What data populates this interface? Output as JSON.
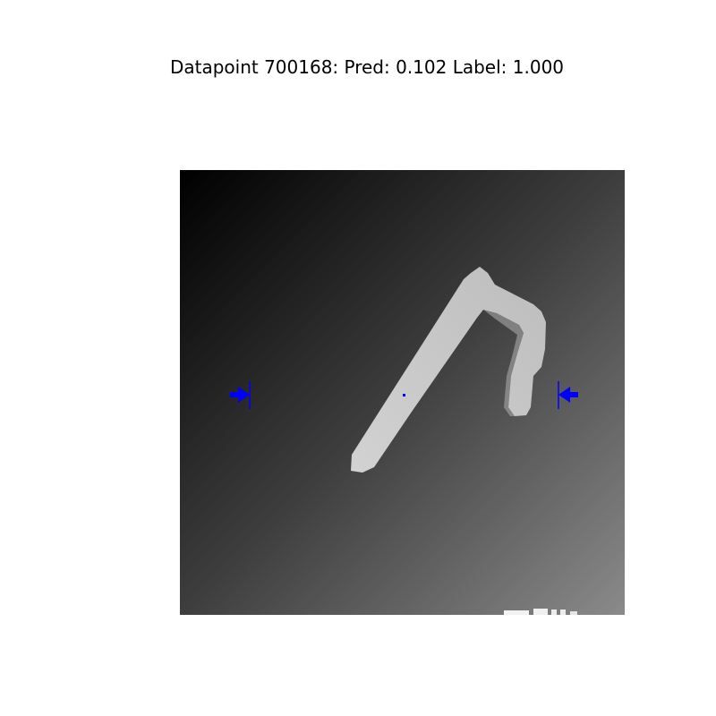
{
  "figure": {
    "title": "Datapoint 700168: Pred: 0.102 Label: 1.000"
  },
  "colors": {
    "background": "#ffffff",
    "marker": "#0000ff",
    "gradient_dark": "#000000",
    "gradient_light": "#8a8a8a",
    "object": "#c8c8c8"
  },
  "icons": {
    "left_marker": "arrow-right-icon",
    "right_marker": "arrow-left-icon",
    "center_marker": "center-dot-icon"
  }
}
